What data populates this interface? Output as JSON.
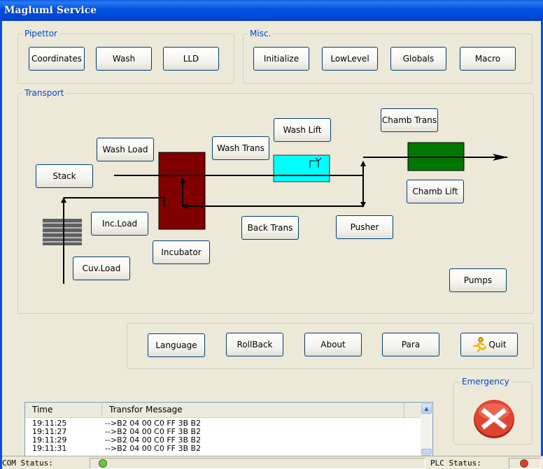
{
  "window": {
    "title": "Maglumi Service"
  },
  "pipettor": {
    "legend": "Pipettor",
    "buttons": {
      "coordinates": "Coordinates",
      "wash": "Wash",
      "lld": "LLD"
    }
  },
  "misc": {
    "legend": "Misc.",
    "buttons": {
      "initialize": "Initialize",
      "lowlevel": "LowLevel",
      "globals": "Globals",
      "macro": "Macro"
    }
  },
  "transport": {
    "legend": "Transport",
    "buttons": {
      "stack": "Stack",
      "wash_load": "Wash Load",
      "wash_trans": "Wash Trans",
      "wash_lift": "Wash Lift",
      "chamb_trans": "Chamb Trans",
      "chamb_lift": "Chamb Lift",
      "inc_load": "Inc.Load",
      "incubator": "Incubator",
      "back_trans": "Back Trans",
      "pusher": "Pusher",
      "cuv_load": "Cuv.Load",
      "pumps": "Pumps"
    },
    "colors": {
      "incubator": "#800000",
      "wash_station": "#00ffff",
      "chamber": "#007700"
    }
  },
  "bottom": {
    "buttons": {
      "language": "Language",
      "rollback": "RollBack",
      "about": "About",
      "para": "Para",
      "quit": "Quit"
    }
  },
  "log": {
    "columns": {
      "time": "Time",
      "message": "Transfor Message"
    },
    "rows": [
      {
        "time": "19:11:25",
        "message": "-->B2 04 00 C0 FF 3B B2"
      },
      {
        "time": "19:11:27",
        "message": "-->B2 04 00 C0 FF 3B B2"
      },
      {
        "time": "19:11:29",
        "message": "-->B2 04 00 C0 FF 3B B2"
      },
      {
        "time": "19:11:31",
        "message": "-->B2 04 00 C0 FF 3B B2"
      }
    ]
  },
  "emergency": {
    "legend": "Emergency",
    "icon": "stop-x-icon"
  },
  "status": {
    "com_label": "COM Status:",
    "com_color": "#66cc33",
    "plc_label": "PLC Status:",
    "plc_color": "#e03c1e"
  }
}
